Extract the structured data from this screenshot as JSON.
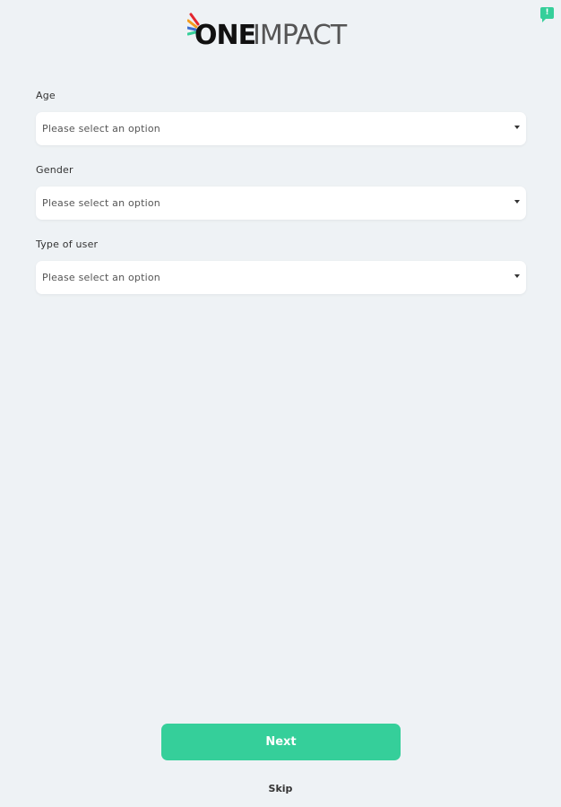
{
  "feedback": {
    "badge_text": "!"
  },
  "logo": {
    "part_one": "ONE",
    "part_two": "IMPACT",
    "ray_colors": [
      "#e4262e",
      "#f39c1f",
      "#3f6fd1",
      "#35cf9a"
    ]
  },
  "form": {
    "fields": [
      {
        "label": "Age",
        "placeholder": "Please select an option"
      },
      {
        "label": "Gender",
        "placeholder": "Please select an option"
      },
      {
        "label": "Type of user",
        "placeholder": "Please select an option"
      }
    ]
  },
  "actions": {
    "next_label": "Next",
    "skip_label": "Skip"
  },
  "colors": {
    "accent": "#35cf9a",
    "background": "#eef2f5"
  }
}
